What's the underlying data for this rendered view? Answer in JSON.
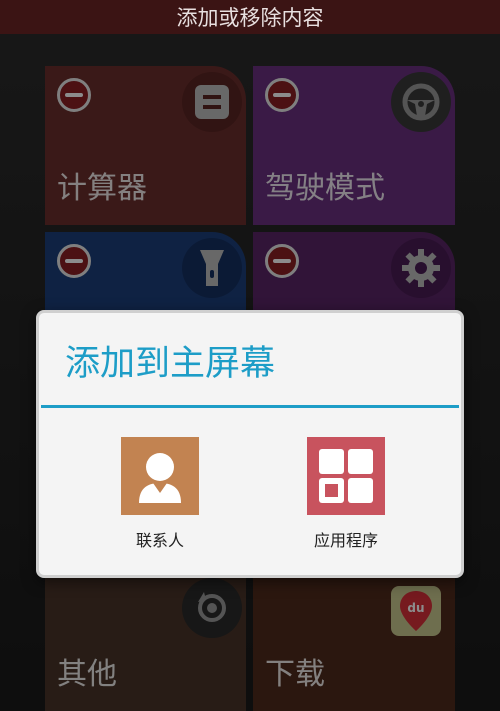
{
  "status_bar": {
    "title": "添加或移除内容"
  },
  "tiles": [
    {
      "label": "计算器",
      "icon": "calculator-icon",
      "color": "#6b2f2c"
    },
    {
      "label": "驾驶模式",
      "icon": "steering-wheel-icon",
      "color": "#6a3180"
    },
    {
      "label": "",
      "icon": "flashlight-icon",
      "color": "#1d3f7a"
    },
    {
      "label": "",
      "icon": "gear-icon",
      "color": "#5a2566"
    },
    {
      "label": "其他",
      "icon": "rotate-icon",
      "color": "#4a3428"
    },
    {
      "label": "下载",
      "icon": "baidu-map-icon",
      "color": "#4f2a1c"
    }
  ],
  "dialog": {
    "title": "添加到主屏幕",
    "options": [
      {
        "label": "联系人",
        "icon": "contact-icon",
        "color": "#c28351"
      },
      {
        "label": "应用程序",
        "icon": "apps-grid-icon",
        "color": "#c8535e"
      }
    ]
  }
}
